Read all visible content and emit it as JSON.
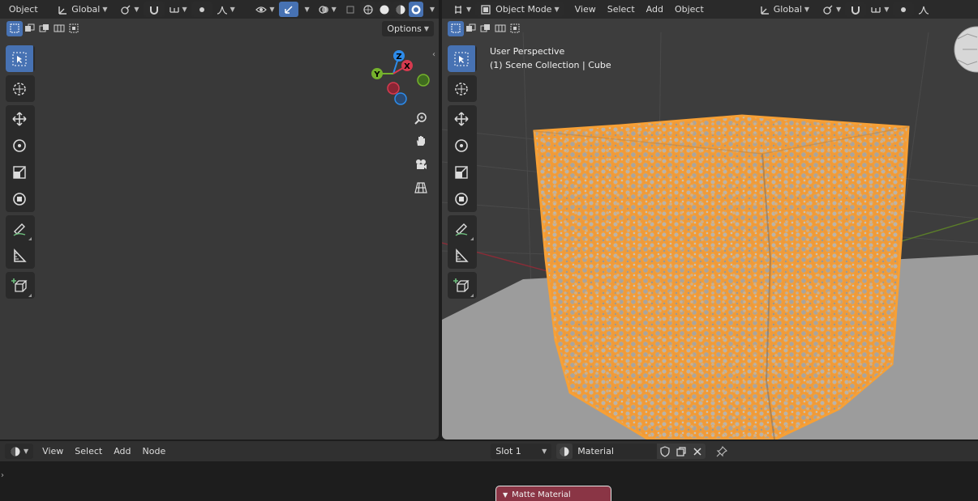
{
  "left_header": {
    "mode_label": "Object",
    "orientation_label": "Global",
    "options_label": "Options"
  },
  "right_header": {
    "mode_label": "Object Mode",
    "menus": [
      "View",
      "Select",
      "Add",
      "Object"
    ],
    "orientation_label": "Global"
  },
  "viewport_overlay": {
    "perspective_label": "User Perspective",
    "collection_label": "(1) Scene Collection | Cube"
  },
  "gizmo": {
    "axes": [
      "X",
      "Y",
      "Z"
    ],
    "colors": {
      "x": "#d63a4f",
      "y": "#75b22c",
      "z": "#2d8ceb"
    }
  },
  "node_header": {
    "menus": [
      "View",
      "Select",
      "Add",
      "Node"
    ],
    "slot_label": "Slot 1",
    "material_name": "Material"
  },
  "node": {
    "title": "Matte Material",
    "color": "#8a3545"
  },
  "theme": {
    "accent": "#4772b3",
    "selection_orange": "#f7a035",
    "floor": "#9c9c9c"
  },
  "icons": [
    "select-box-icon",
    "cursor-icon",
    "move-icon",
    "rotate-icon",
    "scale-icon",
    "transform-icon",
    "annotate-icon",
    "measure-icon",
    "add-cube-icon",
    "zoom-icon",
    "hand-icon",
    "camera-icon",
    "grid-icon",
    "pin-icon",
    "shield-icon",
    "duplicate-icon",
    "close-icon"
  ]
}
